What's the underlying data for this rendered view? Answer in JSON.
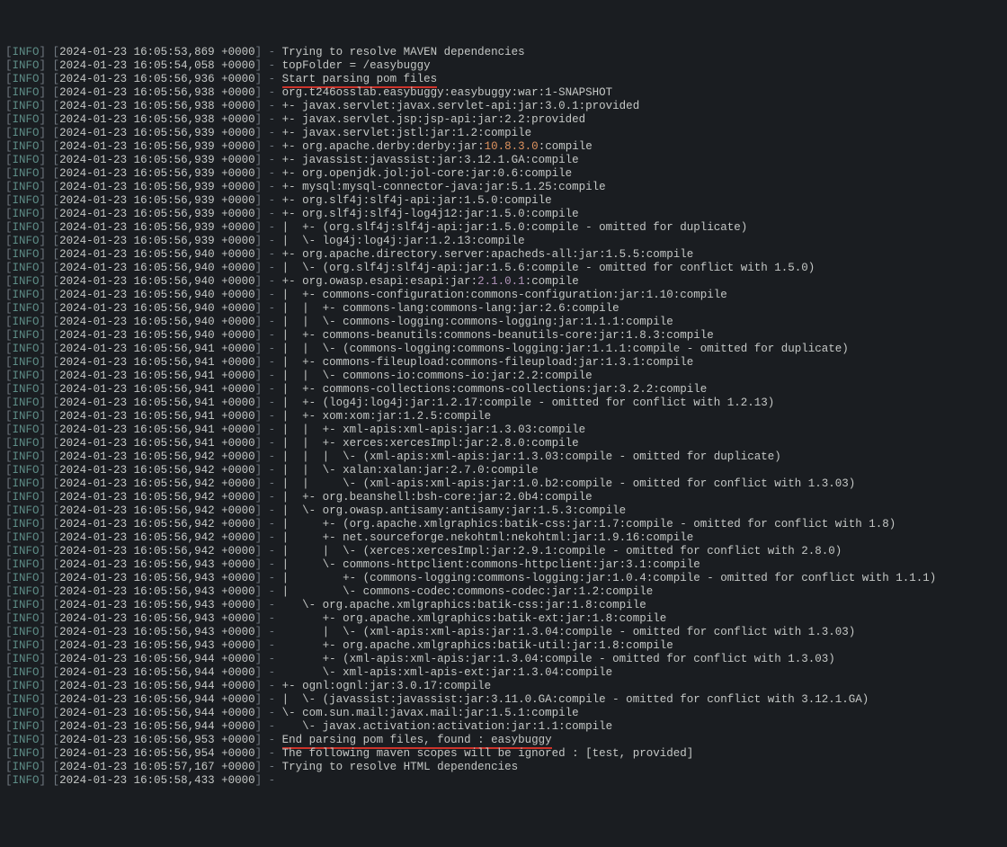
{
  "lines": [
    {
      "level": "INFO",
      "ts": "2024-01-23 16:05:53,869 +0000",
      "msg": "Trying to resolve MAVEN dependencies"
    },
    {
      "level": "INFO",
      "ts": "2024-01-23 16:05:54,058 +0000",
      "msg": "topFolder = /easybuggy"
    },
    {
      "level": "INFO",
      "ts": "2024-01-23 16:05:56,936 +0000",
      "msg": "Start parsing pom files",
      "underline": true
    },
    {
      "level": "INFO",
      "ts": "2024-01-23 16:05:56,938 +0000",
      "msg": "org.t246osslab.easybuggy:easybuggy:war:1-SNAPSHOT"
    },
    {
      "level": "INFO",
      "ts": "2024-01-23 16:05:56,938 +0000",
      "msg": "+- javax.servlet:javax.servlet-api:jar:3.0.1:provided"
    },
    {
      "level": "INFO",
      "ts": "2024-01-23 16:05:56,938 +0000",
      "msg": "+- javax.servlet.jsp:jsp-api:jar:2.2:provided"
    },
    {
      "level": "INFO",
      "ts": "2024-01-23 16:05:56,939 +0000",
      "msg": "+- javax.servlet:jstl:jar:1.2:compile"
    },
    {
      "level": "INFO",
      "ts": "2024-01-23 16:05:56,939 +0000",
      "msg": "+- org.apache.derby:derby:jar:",
      "orange": "10.8.3.0",
      "msg2": ":compile"
    },
    {
      "level": "INFO",
      "ts": "2024-01-23 16:05:56,939 +0000",
      "msg": "+- javassist:javassist:jar:3.12.1.GA:compile"
    },
    {
      "level": "INFO",
      "ts": "2024-01-23 16:05:56,939 +0000",
      "msg": "+- org.openjdk.jol:jol-core:jar:0.6:compile"
    },
    {
      "level": "INFO",
      "ts": "2024-01-23 16:05:56,939 +0000",
      "msg": "+- mysql:mysql-connector-java:jar:5.1.25:compile"
    },
    {
      "level": "INFO",
      "ts": "2024-01-23 16:05:56,939 +0000",
      "msg": "+- org.slf4j:slf4j-api:jar:1.5.0:compile"
    },
    {
      "level": "INFO",
      "ts": "2024-01-23 16:05:56,939 +0000",
      "msg": "+- org.slf4j:slf4j-log4j12:jar:1.5.0:compile"
    },
    {
      "level": "INFO",
      "ts": "2024-01-23 16:05:56,939 +0000",
      "msg": "|  +- (org.slf4j:slf4j-api:jar:1.5.0:compile - omitted for duplicate)"
    },
    {
      "level": "INFO",
      "ts": "2024-01-23 16:05:56,939 +0000",
      "msg": "|  \\- log4j:log4j:jar:1.2.13:compile"
    },
    {
      "level": "INFO",
      "ts": "2024-01-23 16:05:56,940 +0000",
      "msg": "+- org.apache.directory.server:apacheds-all:jar:1.5.5:compile"
    },
    {
      "level": "INFO",
      "ts": "2024-01-23 16:05:56,940 +0000",
      "msg": "|  \\- (org.slf4j:slf4j-api:jar:1.5.6:compile - omitted for conflict with 1.5.0)"
    },
    {
      "level": "INFO",
      "ts": "2024-01-23 16:05:56,940 +0000",
      "msg": "+- org.owasp.esapi:esapi:jar:",
      "pink": "2.1.0.1",
      "msg2": ":compile"
    },
    {
      "level": "INFO",
      "ts": "2024-01-23 16:05:56,940 +0000",
      "msg": "|  +- commons-configuration:commons-configuration:jar:1.10:compile"
    },
    {
      "level": "INFO",
      "ts": "2024-01-23 16:05:56,940 +0000",
      "msg": "|  |  +- commons-lang:commons-lang:jar:2.6:compile"
    },
    {
      "level": "INFO",
      "ts": "2024-01-23 16:05:56,940 +0000",
      "msg": "|  |  \\- commons-logging:commons-logging:jar:1.1.1:compile"
    },
    {
      "level": "INFO",
      "ts": "2024-01-23 16:05:56,940 +0000",
      "msg": "|  +- commons-beanutils:commons-beanutils-core:jar:1.8.3:compile"
    },
    {
      "level": "INFO",
      "ts": "2024-01-23 16:05:56,941 +0000",
      "msg": "|  |  \\- (commons-logging:commons-logging:jar:1.1.1:compile - omitted for duplicate)"
    },
    {
      "level": "INFO",
      "ts": "2024-01-23 16:05:56,941 +0000",
      "msg": "|  +- commons-fileupload:commons-fileupload:jar:1.3.1:compile"
    },
    {
      "level": "INFO",
      "ts": "2024-01-23 16:05:56,941 +0000",
      "msg": "|  |  \\- commons-io:commons-io:jar:2.2:compile"
    },
    {
      "level": "INFO",
      "ts": "2024-01-23 16:05:56,941 +0000",
      "msg": "|  +- commons-collections:commons-collections:jar:3.2.2:compile"
    },
    {
      "level": "INFO",
      "ts": "2024-01-23 16:05:56,941 +0000",
      "msg": "|  +- (log4j:log4j:jar:1.2.17:compile - omitted for conflict with 1.2.13)"
    },
    {
      "level": "INFO",
      "ts": "2024-01-23 16:05:56,941 +0000",
      "msg": "|  +- xom:xom:jar:1.2.5:compile"
    },
    {
      "level": "INFO",
      "ts": "2024-01-23 16:05:56,941 +0000",
      "msg": "|  |  +- xml-apis:xml-apis:jar:1.3.03:compile"
    },
    {
      "level": "INFO",
      "ts": "2024-01-23 16:05:56,941 +0000",
      "msg": "|  |  +- xerces:xercesImpl:jar:2.8.0:compile"
    },
    {
      "level": "INFO",
      "ts": "2024-01-23 16:05:56,942 +0000",
      "msg": "|  |  |  \\- (xml-apis:xml-apis:jar:1.3.03:compile - omitted for duplicate)"
    },
    {
      "level": "INFO",
      "ts": "2024-01-23 16:05:56,942 +0000",
      "msg": "|  |  \\- xalan:xalan:jar:2.7.0:compile"
    },
    {
      "level": "INFO",
      "ts": "2024-01-23 16:05:56,942 +0000",
      "msg": "|  |     \\- (xml-apis:xml-apis:jar:1.0.b2:compile - omitted for conflict with 1.3.03)"
    },
    {
      "level": "INFO",
      "ts": "2024-01-23 16:05:56,942 +0000",
      "msg": "|  +- org.beanshell:bsh-core:jar:2.0b4:compile"
    },
    {
      "level": "INFO",
      "ts": "2024-01-23 16:05:56,942 +0000",
      "msg": "|  \\- org.owasp.antisamy:antisamy:jar:1.5.3:compile"
    },
    {
      "level": "INFO",
      "ts": "2024-01-23 16:05:56,942 +0000",
      "msg": "|     +- (org.apache.xmlgraphics:batik-css:jar:1.7:compile - omitted for conflict with 1.8)"
    },
    {
      "level": "INFO",
      "ts": "2024-01-23 16:05:56,942 +0000",
      "msg": "|     +- net.sourceforge.nekohtml:nekohtml:jar:1.9.16:compile"
    },
    {
      "level": "INFO",
      "ts": "2024-01-23 16:05:56,942 +0000",
      "msg": "|     |  \\- (xerces:xercesImpl:jar:2.9.1:compile - omitted for conflict with 2.8.0)"
    },
    {
      "level": "INFO",
      "ts": "2024-01-23 16:05:56,943 +0000",
      "msg": "|     \\- commons-httpclient:commons-httpclient:jar:3.1:compile"
    },
    {
      "level": "INFO",
      "ts": "2024-01-23 16:05:56,943 +0000",
      "msg": "|        +- (commons-logging:commons-logging:jar:1.0.4:compile - omitted for conflict with 1.1.1)"
    },
    {
      "level": "INFO",
      "ts": "2024-01-23 16:05:56,943 +0000",
      "msg": "|        \\- commons-codec:commons-codec:jar:1.2:compile"
    },
    {
      "level": "INFO",
      "ts": "2024-01-23 16:05:56,943 +0000",
      "msg": "   \\- org.apache.xmlgraphics:batik-css:jar:1.8:compile"
    },
    {
      "level": "INFO",
      "ts": "2024-01-23 16:05:56,943 +0000",
      "msg": "      +- org.apache.xmlgraphics:batik-ext:jar:1.8:compile"
    },
    {
      "level": "INFO",
      "ts": "2024-01-23 16:05:56,943 +0000",
      "msg": "      |  \\- (xml-apis:xml-apis:jar:1.3.04:compile - omitted for conflict with 1.3.03)"
    },
    {
      "level": "INFO",
      "ts": "2024-01-23 16:05:56,943 +0000",
      "msg": "      +- org.apache.xmlgraphics:batik-util:jar:1.8:compile"
    },
    {
      "level": "INFO",
      "ts": "2024-01-23 16:05:56,944 +0000",
      "msg": "      +- (xml-apis:xml-apis:jar:1.3.04:compile - omitted for conflict with 1.3.03)"
    },
    {
      "level": "INFO",
      "ts": "2024-01-23 16:05:56,944 +0000",
      "msg": "      \\- xml-apis:xml-apis-ext:jar:1.3.04:compile"
    },
    {
      "level": "INFO",
      "ts": "2024-01-23 16:05:56,944 +0000",
      "msg": "+- ognl:ognl:jar:3.0.17:compile"
    },
    {
      "level": "INFO",
      "ts": "2024-01-23 16:05:56,944 +0000",
      "msg": "|  \\- (javassist:javassist:jar:3.11.0.GA:compile - omitted for conflict with 3.12.1.GA)"
    },
    {
      "level": "INFO",
      "ts": "2024-01-23 16:05:56,944 +0000",
      "msg": "\\- com.sun.mail:javax.mail:jar:1.5.1:compile"
    },
    {
      "level": "INFO",
      "ts": "2024-01-23 16:05:56,944 +0000",
      "msg": "   \\- javax.activation:activation:jar:1.1:compile"
    },
    {
      "level": "INFO",
      "ts": "2024-01-23 16:05:56,953 +0000",
      "msg": "End parsing pom files, found : easybuggy",
      "underline": true
    },
    {
      "level": "INFO",
      "ts": "2024-01-23 16:05:56,954 +0000",
      "msg": "The following maven scopes will be ignored : [test, provided]"
    },
    {
      "level": "INFO",
      "ts": "2024-01-23 16:05:57,167 +0000",
      "msg": "Trying to resolve HTML dependencies"
    },
    {
      "level": "INFO",
      "ts": "2024-01-23 16:05:58,433 +0000",
      "msg": ""
    }
  ]
}
